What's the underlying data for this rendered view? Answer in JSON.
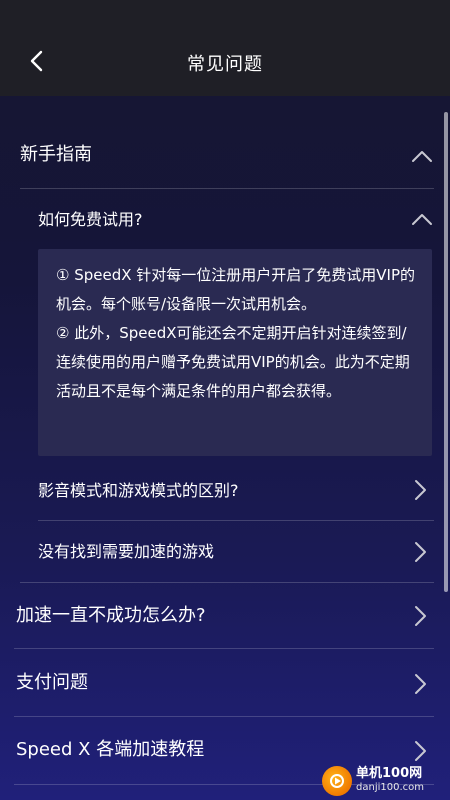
{
  "header": {
    "title": "常见问题"
  },
  "sections": [
    {
      "label": "新手指南",
      "expanded": true
    },
    {
      "label": "加速一直不成功怎么办?",
      "expanded": false
    },
    {
      "label": "支付问题",
      "expanded": false
    },
    {
      "label": "Speed X 各端加速教程",
      "expanded": false
    }
  ],
  "questions": [
    {
      "label": "如何免费试用?",
      "expanded": true,
      "answer": [
        "① SpeedX 针对每一位注册用户开启了免费试用VIP的机会。每个账号/设备限一次试用机会。",
        "② 此外，SpeedX可能还会不定期开启针对连续签到/连续使用的用户赠予免费试用VIP的机会。此为不定期活动且不是每个满足条件的用户都会获得。"
      ]
    },
    {
      "label": "影音模式和游戏模式的区别?",
      "expanded": false
    },
    {
      "label": "没有找到需要加速的游戏",
      "expanded": false
    }
  ],
  "watermark": {
    "name": "单机100网",
    "url": "danji100.com"
  },
  "colors": {
    "header_bg": "#1f1f26",
    "answer_bg": "#2a2a52",
    "chevron": "#c8c8d2"
  }
}
